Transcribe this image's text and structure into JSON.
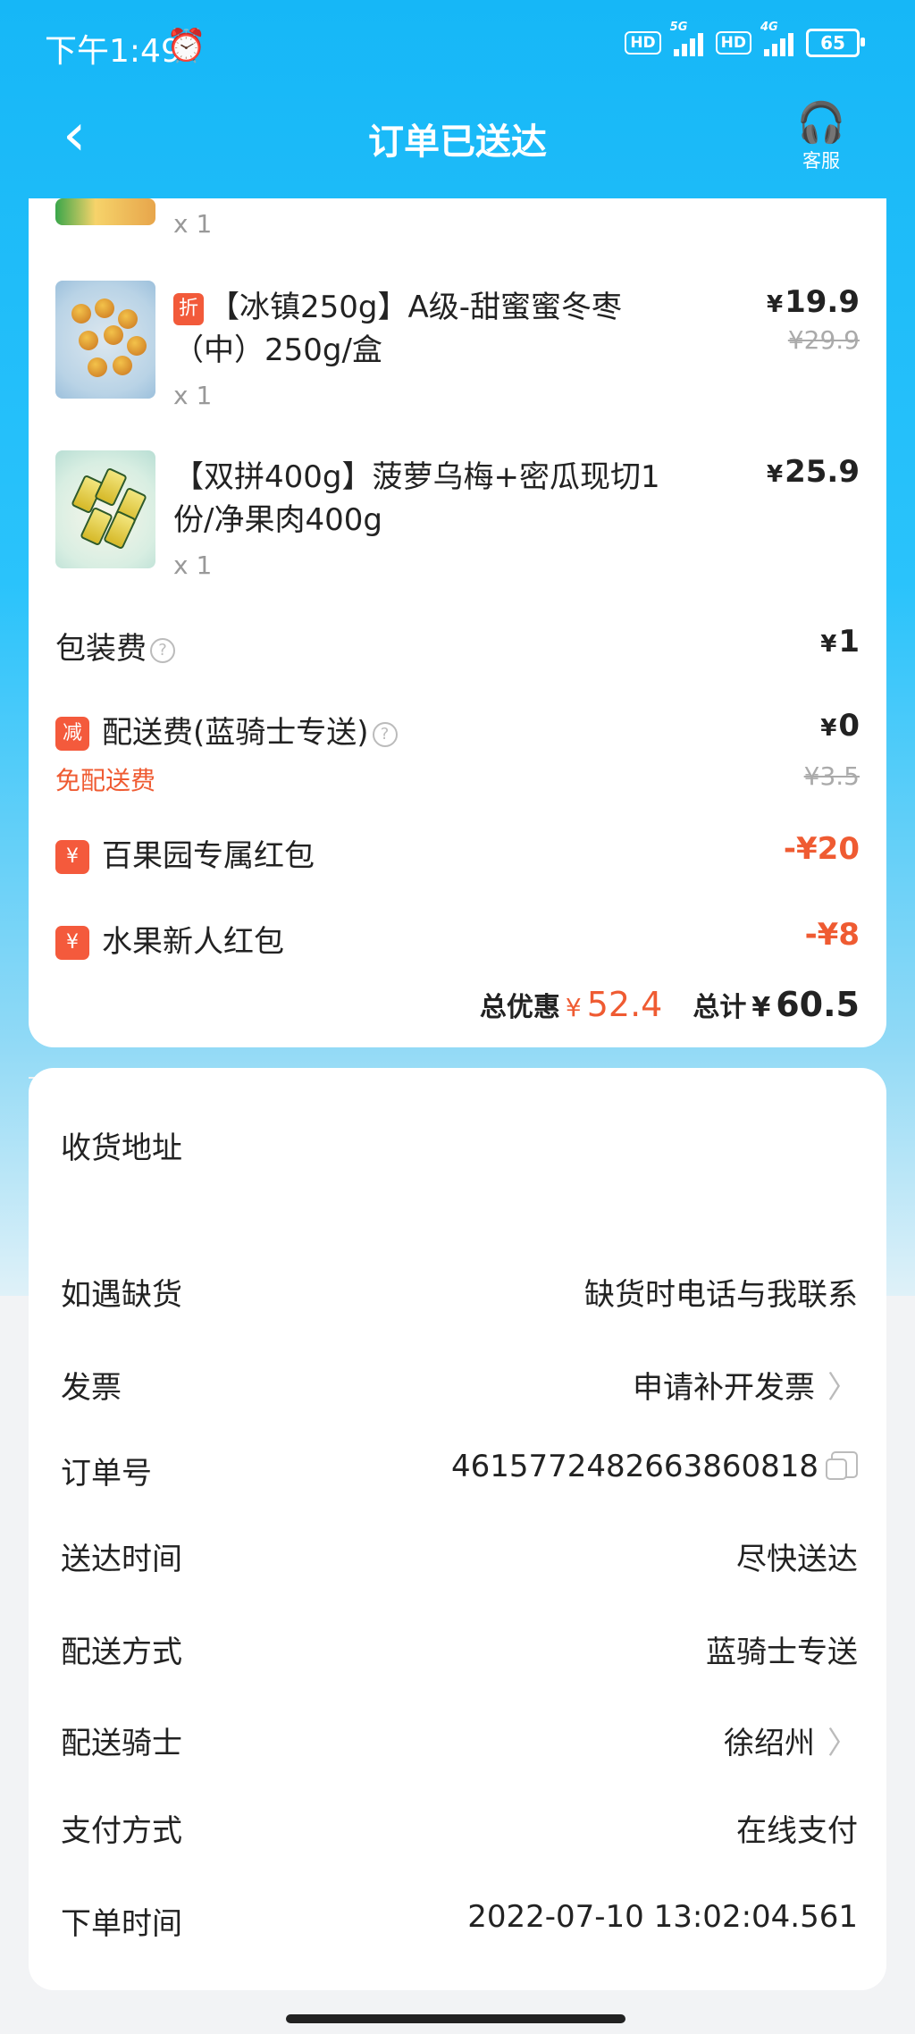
{
  "status_bar": {
    "time": "下午1:49",
    "hd1": "HD",
    "net1": "5G",
    "hd2": "HD",
    "net2": "4G",
    "battery": "65"
  },
  "nav": {
    "back_icon": "chevron-left-icon",
    "title": "订单已送达",
    "service_label": "客服",
    "service_icon": "headset-icon"
  },
  "items": [
    {
      "title": "",
      "qty": "x 1"
    },
    {
      "tag": "折",
      "title": "【冰镇250g】A级-甜蜜蜜冬枣（中）250g/盒",
      "qty": "x 1",
      "price": "19.9",
      "old_price": "¥29.9"
    },
    {
      "title": "【双拼400g】菠萝乌梅+密瓜现切1份/净果肉400g",
      "qty": "x 1",
      "price": "25.9"
    }
  ],
  "fees": {
    "packing_label": "包装费",
    "packing_value": "1",
    "delivery_badge": "减",
    "delivery_label": "配送费(蓝骑士专送)",
    "delivery_value": "0",
    "free_delivery": "免配送费",
    "delivery_old": "¥3.5",
    "coupon1_badge": "¥",
    "coupon1_label": "百果园专属红包",
    "coupon1_value": "-¥20",
    "coupon2_badge": "¥",
    "coupon2_label": "水果新人红包",
    "coupon2_value": "-¥8"
  },
  "summary": {
    "discount_label": "总优惠",
    "discount_currency": "¥",
    "discount_value": "52.4",
    "total_label": "总计",
    "total_currency": "¥",
    "total_value": "60.5"
  },
  "info": {
    "address_label": "收货地址",
    "stockout_label": "如遇缺货",
    "stockout_value": "缺货时电话与我联系",
    "invoice_label": "发票",
    "invoice_value": "申请补开发票",
    "order_no_label": "订单号",
    "order_no_value": "4615772482663860818",
    "arrive_label": "送达时间",
    "arrive_value": "尽快送达",
    "method_label": "配送方式",
    "method_value": "蓝骑士专送",
    "rider_label": "配送骑士",
    "rider_value": "徐绍州",
    "pay_label": "支付方式",
    "pay_value": "在线支付",
    "ordertime_label": "下单时间",
    "ordertime_value": "2022-07-10 13:02:04.561"
  },
  "colors": {
    "header_blue": "#16b7f7",
    "accent_orange": "#ef5b32",
    "badge_red": "#f45a3c"
  }
}
